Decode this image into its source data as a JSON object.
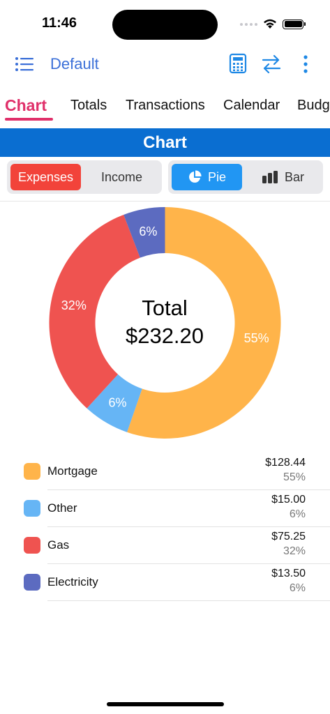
{
  "status_bar": {
    "time": "11:46"
  },
  "top_bar": {
    "title": "Default"
  },
  "tabs": [
    {
      "label": "Chart",
      "active": true
    },
    {
      "label": "Totals"
    },
    {
      "label": "Transactions"
    },
    {
      "label": "Calendar"
    },
    {
      "label": "Budg"
    }
  ],
  "section_title": "Chart",
  "type_toggle": {
    "expenses": "Expenses",
    "income": "Income",
    "selected": "Expenses"
  },
  "chart_toggle": {
    "pie": "Pie",
    "bar": "Bar",
    "selected": "Pie"
  },
  "center": {
    "label": "Total",
    "amount": "$232.20"
  },
  "colors": {
    "mortgage": "#ffb44a",
    "other": "#66b5f5",
    "gas": "#ef5350",
    "electricity": "#5c6bc0",
    "accent_tab": "#e0306a",
    "header_blue": "#0a6ed1"
  },
  "chart_data": {
    "type": "pie",
    "donut": true,
    "total": 232.2,
    "series": [
      {
        "name": "Mortgage",
        "value": 128.44,
        "percent_label": "55%",
        "color": "#ffb44a"
      },
      {
        "name": "Other",
        "value": 15.0,
        "percent_label": "6%",
        "color": "#66b5f5"
      },
      {
        "name": "Gas",
        "value": 75.25,
        "percent_label": "32%",
        "color": "#ef5350"
      },
      {
        "name": "Electricity",
        "value": 13.5,
        "percent_label": "6%",
        "color": "#5c6bc0"
      }
    ]
  },
  "legend": [
    {
      "name": "Mortgage",
      "amount": "$128.44",
      "percent": "55%",
      "color": "#ffb44a"
    },
    {
      "name": "Other",
      "amount": "$15.00",
      "percent": "6%",
      "color": "#66b5f5"
    },
    {
      "name": "Gas",
      "amount": "$75.25",
      "percent": "32%",
      "color": "#ef5350"
    },
    {
      "name": "Electricity",
      "amount": "$13.50",
      "percent": "6%",
      "color": "#5c6bc0"
    }
  ],
  "icons": {
    "menu": "list-icon",
    "calculator": "calculator-icon",
    "swap": "swap-arrows-icon",
    "more": "more-vertical-icon",
    "pie": "pie-chart-icon",
    "bar": "bar-chart-icon"
  }
}
